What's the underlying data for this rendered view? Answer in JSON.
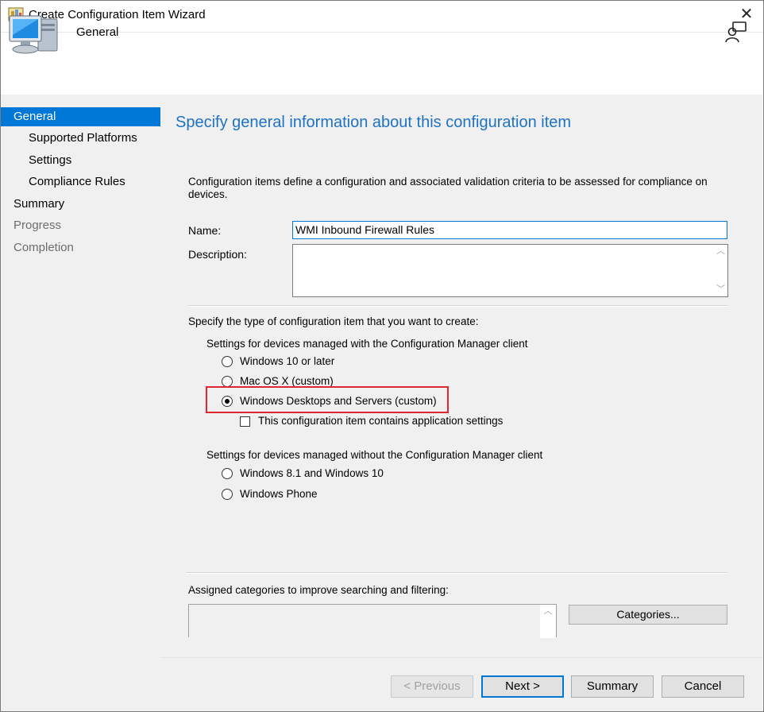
{
  "window": {
    "title": "Create Configuration Item Wizard"
  },
  "header": {
    "page_label": "General"
  },
  "nav": {
    "items": [
      {
        "label": "General",
        "state": "active",
        "level": 0
      },
      {
        "label": "Supported Platforms",
        "state": "normal",
        "level": 1
      },
      {
        "label": "Settings",
        "state": "normal",
        "level": 1
      },
      {
        "label": "Compliance Rules",
        "state": "normal",
        "level": 1
      },
      {
        "label": "Summary",
        "state": "normal",
        "level": 0
      },
      {
        "label": "Progress",
        "state": "disabled",
        "level": 0
      },
      {
        "label": "Completion",
        "state": "disabled",
        "level": 0
      }
    ]
  },
  "main": {
    "title": "Specify general information about this configuration item",
    "intro": "Configuration items define a configuration and associated validation criteria to be assessed for compliance on devices.",
    "name_label": "Name:",
    "name_value": "WMI Inbound Firewall Rules",
    "description_label": "Description:",
    "description_value": "",
    "type_prompt": "Specify the type of configuration item that you want to create:",
    "client_group_label": "Settings for devices managed with the Configuration Manager client",
    "client_options": [
      {
        "label": "Windows 10 or later",
        "selected": false
      },
      {
        "label": "Mac OS X (custom)",
        "selected": false
      },
      {
        "label": "Windows Desktops and Servers (custom)",
        "selected": true
      }
    ],
    "app_settings_checkbox": {
      "label": "This configuration item contains application settings",
      "checked": false
    },
    "no_client_group_label": "Settings for devices managed without the Configuration Manager client",
    "no_client_options": [
      {
        "label": "Windows 8.1 and Windows 10",
        "selected": false
      },
      {
        "label": "Windows Phone",
        "selected": false
      }
    ],
    "categories_label": "Assigned categories to improve searching and filtering:",
    "categories_button": "Categories..."
  },
  "footer": {
    "previous_label": "< Previous",
    "next_label": "Next >",
    "summary_label": "Summary",
    "cancel_label": "Cancel"
  },
  "colors": {
    "accent": "#0078d7",
    "title_blue": "#1e72c4",
    "highlight_red": "#e0262e",
    "panel": "#f0f0f0"
  }
}
